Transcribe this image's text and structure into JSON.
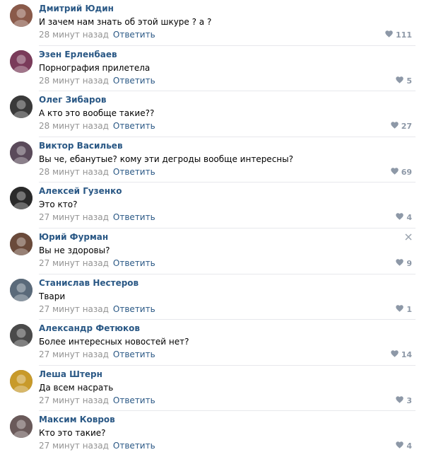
{
  "comments": [
    {
      "author": "Дмитрий Юдин",
      "text": "И зачем нам знать об этой шкуре ? а ?",
      "time": "28 минут назад",
      "reply": "Ответить",
      "likes": "111",
      "avatar_color": "#8a5a4a"
    },
    {
      "author": "Эзен Ерленбаев",
      "text": "Порнография прилетела",
      "time": "28 минут назад",
      "reply": "Ответить",
      "likes": "5",
      "avatar_color": "#7a3b5a"
    },
    {
      "author": "Олег Зибаров",
      "text": "А кто это вообще такие??",
      "time": "28 минут назад",
      "reply": "Ответить",
      "likes": "27",
      "avatar_color": "#3a3a3a"
    },
    {
      "author": "Виктор Васильев",
      "text": "Вы че, ебанутые? кому эти дегроды вообще интересны?",
      "time": "28 минут назад",
      "reply": "Ответить",
      "likes": "69",
      "avatar_color": "#5a4a5a"
    },
    {
      "author": "Алексей Гузенко",
      "text": "Это кто?",
      "time": "27 минут назад",
      "reply": "Ответить",
      "likes": "4",
      "avatar_color": "#2a2a2a"
    },
    {
      "author": "Юрий Фурман",
      "text": "Вы не здоровы?",
      "time": "27 минут назад",
      "reply": "Ответить",
      "likes": "9",
      "avatar_color": "#6a4a3a",
      "has_close": true
    },
    {
      "author": "Станислав Нестеров",
      "text": "Твари",
      "time": "27 минут назад",
      "reply": "Ответить",
      "likes": "1",
      "avatar_color": "#5a6a7a"
    },
    {
      "author": "Александр Фетюков",
      "text": "Более интересных новостей нет?",
      "time": "27 минут назад",
      "reply": "Ответить",
      "likes": "14",
      "avatar_color": "#4a4a4a"
    },
    {
      "author": "Леша Штерн",
      "text": "Да всем насрать",
      "time": "27 минут назад",
      "reply": "Ответить",
      "likes": "3",
      "avatar_color": "#c89a2a"
    },
    {
      "author": "Максим Ковров",
      "text": "Кто это такие?",
      "time": "27 минут назад",
      "reply": "Ответить",
      "likes": "4",
      "avatar_color": "#6a5a5a"
    }
  ],
  "colors": {
    "link": "#2a5885",
    "meta": "#939393",
    "like": "#8d98a7",
    "divider": "#e7e8ec"
  },
  "icons": {
    "like": "heart-icon",
    "close": "close-icon"
  }
}
